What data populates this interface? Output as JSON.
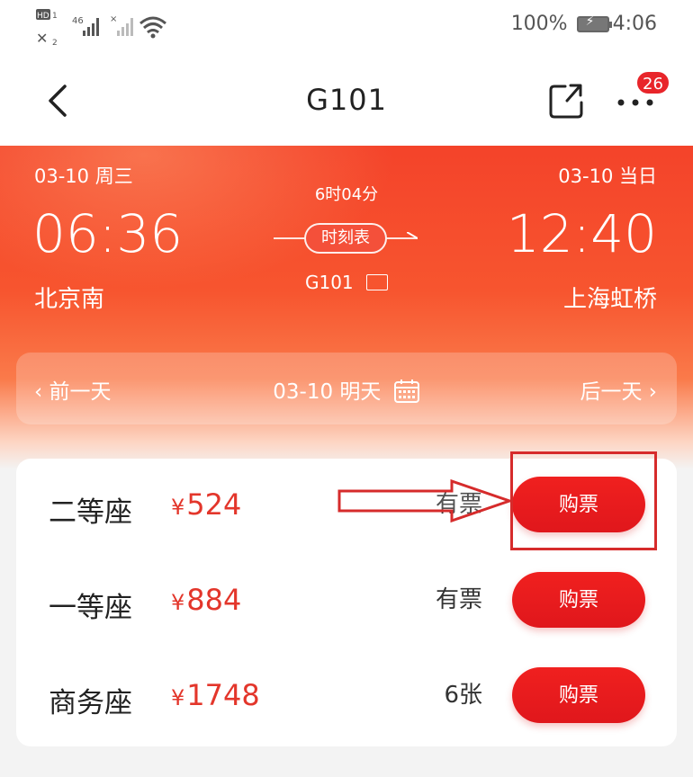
{
  "status_bar": {
    "network_label": "HD 46",
    "battery_text": "100%",
    "time": "4:06"
  },
  "nav": {
    "title": "G101",
    "badge_count": "26"
  },
  "journey": {
    "departure": {
      "date": "03-10 周三",
      "time": "06:36",
      "station": "北京南"
    },
    "arrival": {
      "date": "03-10 当日",
      "time": "12:40",
      "station": "上海虹桥"
    },
    "duration": "6时04分",
    "schedule_label": "时刻表",
    "train_number": "G101"
  },
  "date_nav": {
    "prev": "‹ 前一天",
    "current": "03-10 明天",
    "next": "后一天 ›"
  },
  "seats": [
    {
      "name": "二等座",
      "currency": "¥",
      "price": "524",
      "availability": "有票",
      "action": "购票"
    },
    {
      "name": "一等座",
      "currency": "¥",
      "price": "884",
      "availability": "有票",
      "action": "购票"
    },
    {
      "name": "商务座",
      "currency": "¥",
      "price": "1748",
      "availability": "6张",
      "action": "购票"
    }
  ],
  "colors": {
    "accent": "#e3362b",
    "header_red": "#f4432a",
    "annotation": "#d62b2b"
  },
  "icons": [
    "back-icon",
    "share-icon",
    "more-icon",
    "calendar-icon",
    "train-info-icon",
    "wifi-icon",
    "battery-icon"
  ]
}
